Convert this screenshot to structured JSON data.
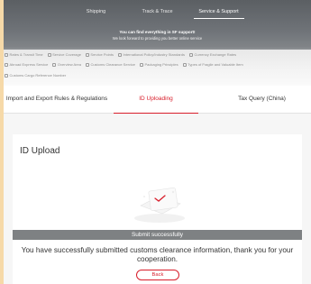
{
  "top_nav": {
    "items": [
      "Shipping",
      "Track & Trace",
      "Service & Support"
    ],
    "active_index": 2
  },
  "hero": {
    "line1": "You can find everything in SF support!",
    "line2": "We look forward to providing you better online service"
  },
  "services": {
    "row1": [
      {
        "icon": "clock-icon",
        "label": "Rates & Transit Time"
      },
      {
        "icon": "globe-icon",
        "label": "Service Coverage"
      },
      {
        "icon": "location-pin-icon",
        "label": "Service Points"
      },
      {
        "icon": "document-icon",
        "label": "International Policy/Industry Standards"
      },
      {
        "icon": "currency-icon",
        "label": "Currency Exchange Rates"
      }
    ],
    "row2": [
      {
        "icon": "truck-icon",
        "label": "Abroad Express Service"
      },
      {
        "icon": "user-icon",
        "label": "Overview Area"
      },
      {
        "icon": "customs-icon",
        "label": "Customs Clearance Service"
      },
      {
        "icon": "box-icon",
        "label": "Packaging Principles"
      },
      {
        "icon": "fragile-icon",
        "label": "Types of Fragile and Valuable Item"
      }
    ],
    "row3": [
      {
        "icon": "search-icon",
        "label": "Customs Cargo Reference Number"
      }
    ]
  },
  "tabs": [
    "Import and Export Rules & Regulations",
    "ID Uploading",
    "Tax Query (China)"
  ],
  "active_tab": "ID Uploading",
  "card": {
    "title": "ID Upload",
    "banner": "Submit successfully",
    "message": "You have successfully submitted customs clearance information, thank you for your cooperation.",
    "back_label": "Back"
  },
  "colors": {
    "accent": "#d81e2b",
    "banner_bg": "#7e8183",
    "page_bg": "#f6f6f6"
  }
}
